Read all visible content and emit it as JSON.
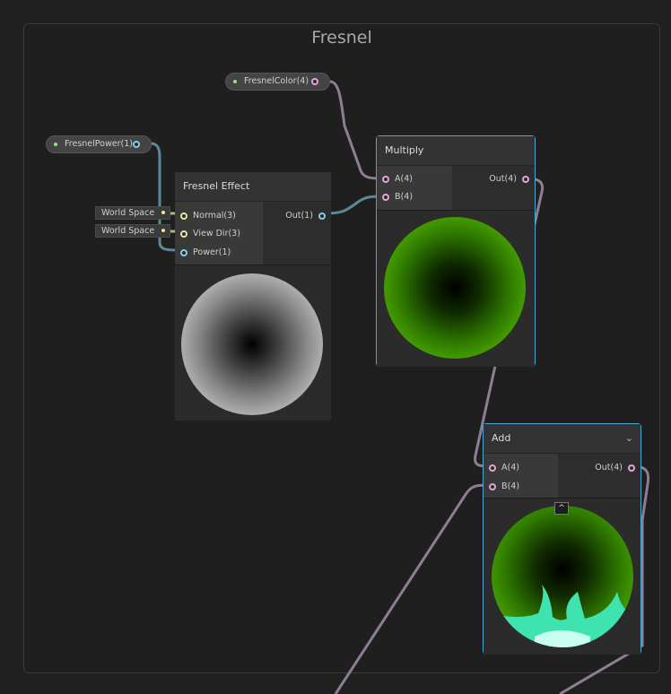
{
  "group": {
    "title": "Fresnel"
  },
  "properties": {
    "fresnel_color": "FresnelColor(4)",
    "fresnel_power": "FresnelPower(1)"
  },
  "fresnel_node": {
    "title": "Fresnel Effect",
    "inputs": [
      "Normal(3)",
      "View Dir(3)",
      "Power(1)"
    ],
    "output": "Out(1)",
    "normal_space": "World Space",
    "viewdir_space": "World Space"
  },
  "multiply_node": {
    "title": "Multiply",
    "inputs": [
      "A(4)",
      "B(4)"
    ],
    "output": "Out(4)"
  },
  "add_node": {
    "title": "Add",
    "inputs": [
      "A(4)",
      "B(4)"
    ],
    "output": "Out(4)",
    "chevron": "⌄",
    "collapse": "^"
  },
  "colors": {
    "wire_color": "#8f7d93",
    "wire_float": "#5a8a98",
    "selection": "#4aa6d6",
    "green": "#5fcc00"
  }
}
